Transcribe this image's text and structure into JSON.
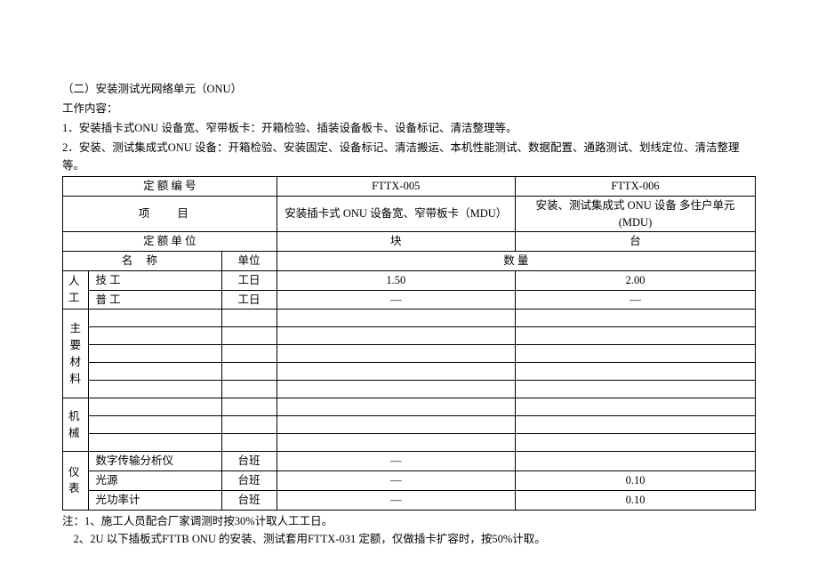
{
  "header": {
    "section_title": "（二）安装测试光网络单元（ONU）",
    "work_content_label": "工作内容：",
    "line1": "1．安装插卡式ONU 设备宽、窄带板卡：开箱检验、插装设备板卡、设备标记、清洁整理等。",
    "line2": "2．安装、测试集成式ONU 设备：开箱检验、安装固定、设备标记、清洁搬运、本机性能测试、数据配置、通路测试、划线定位、清洁整理等。"
  },
  "table": {
    "row_quota_code_label": "定 额 编  号",
    "row_item_label": "项    目",
    "row_quota_unit_label": "定 额 单  位",
    "name_label": "名   称",
    "unit_label": "单位",
    "qty_label": "数            量",
    "code1": "FTTX-005",
    "code2": "FTTX-006",
    "item1": "安装插卡式 ONU 设备宽、窄带板卡（MDU）",
    "item2": "安装、测试集成式 ONU 设备  多住户单元(MDU)",
    "qu1": "块",
    "qu2": "台",
    "cat_labor": "人工",
    "cat_material": "主要材料",
    "cat_mech": "机械",
    "cat_inst": "仪表",
    "labor_skilled": "技 工",
    "labor_unskilled": "普 工",
    "unit_gr": "工日",
    "inst_digital": "数字传输分析仪",
    "inst_light": "光源",
    "inst_power": "光功率计",
    "unit_tb": "台班",
    "v_skilled_1": "1.50",
    "v_skilled_2": "2.00",
    "dash": "—",
    "v_light_2": "0.10",
    "v_power_2": "0.10"
  },
  "notes": {
    "n1": "注：1、施工人员配合厂家调测时按30%计取人工工日。",
    "n2": "    2、2U 以下插板式FTTB ONU 的安装、测试套用FTTX-031 定额，仅做插卡扩容时，按50%计取。"
  }
}
